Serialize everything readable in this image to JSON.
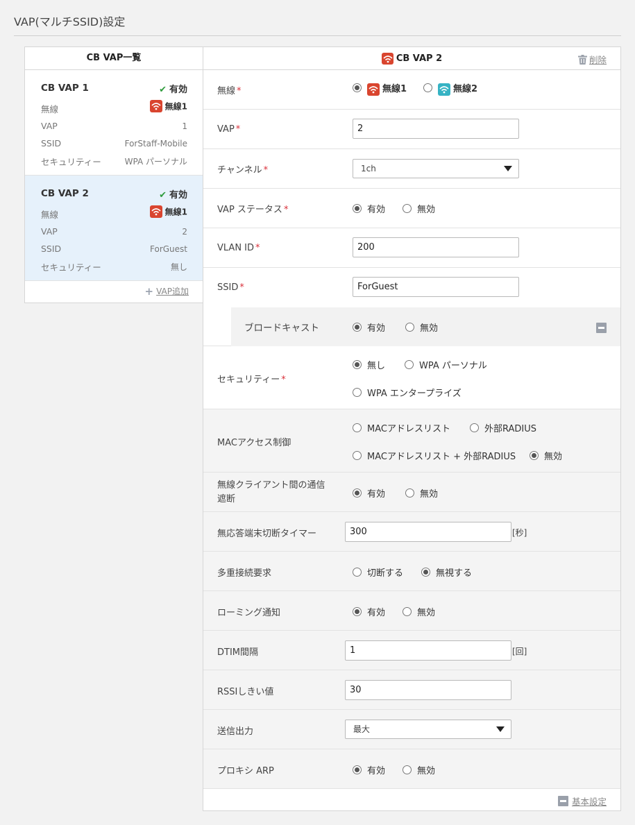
{
  "page": {
    "title": "VAP(マルチSSID)設定"
  },
  "list": {
    "header": "CB VAP一覧",
    "add_label": "VAP追加",
    "field_labels": [
      "無線",
      "VAP",
      "SSID",
      "セキュリティー"
    ],
    "items": [
      {
        "name": "CB VAP 1",
        "status": "有効",
        "radio": "無線1",
        "vap": "1",
        "ssid": "ForStaff-Mobile",
        "security": "WPA パーソナル",
        "selected": false
      },
      {
        "name": "CB VAP 2",
        "status": "有効",
        "radio": "無線1",
        "vap": "2",
        "ssid": "ForGuest",
        "security": "無し",
        "selected": true
      }
    ]
  },
  "detail": {
    "title": "CB VAP 2",
    "delete_label": "削除",
    "basic_settings_label": "基本設定",
    "radio": {
      "label": "無線",
      "options": [
        "無線1",
        "無線2"
      ],
      "selected": "無線1"
    },
    "vap": {
      "label": "VAP",
      "value": "2"
    },
    "channel": {
      "label": "チャンネル",
      "value": "1ch"
    },
    "vap_status": {
      "label": "VAP ステータス",
      "options": [
        "有効",
        "無効"
      ],
      "selected": "有効"
    },
    "vlan_id": {
      "label": "VLAN ID",
      "value": "200"
    },
    "ssid": {
      "label": "SSID",
      "value": "ForGuest"
    },
    "broadcast": {
      "label": "ブロードキャスト",
      "options": [
        "有効",
        "無効"
      ],
      "selected": "有効"
    },
    "security": {
      "label": "セキュリティー",
      "options": [
        "無し",
        "WPA パーソナル",
        "WPA エンタープライズ"
      ],
      "selected": "無し"
    },
    "mac_access": {
      "label": "MACアクセス制御",
      "options": [
        "MACアドレスリスト",
        "外部RADIUS",
        "MACアドレスリスト + 外部RADIUS",
        "無効"
      ],
      "selected": "無効"
    },
    "client_isolation": {
      "label_line1": "無線クライアント間の通信",
      "label_line2": "遮断",
      "options": [
        "有効",
        "無効"
      ],
      "selected": "有効"
    },
    "idle_timer": {
      "label": "無応答端末切断タイマー",
      "value": "300",
      "unit": "[秒]"
    },
    "multi_conn": {
      "label": "多重接続要求",
      "options": [
        "切断する",
        "無視する"
      ],
      "selected": "無視する"
    },
    "roaming": {
      "label": "ローミング通知",
      "options": [
        "有効",
        "無効"
      ],
      "selected": "有効"
    },
    "dtim": {
      "label": "DTIM間隔",
      "value": "1",
      "unit": "[回]"
    },
    "rssi": {
      "label": "RSSIしきい値",
      "value": "30"
    },
    "tx_power": {
      "label": "送信出力",
      "value": "最大"
    },
    "proxy_arp": {
      "label": "プロキシ ARP",
      "options": [
        "有効",
        "無効"
      ],
      "selected": "有効"
    }
  },
  "colors": {
    "required": "#d9303a",
    "radio1_badge": "#d9452f",
    "radio2_badge": "#36b3c4",
    "selected_card": "#e6f1fb",
    "enabled_check": "#2e9b3c"
  },
  "icons": [
    "wifi-icon",
    "check-icon",
    "trash-icon",
    "plus-icon",
    "collapse-icon",
    "dropdown-arrow-icon"
  ]
}
